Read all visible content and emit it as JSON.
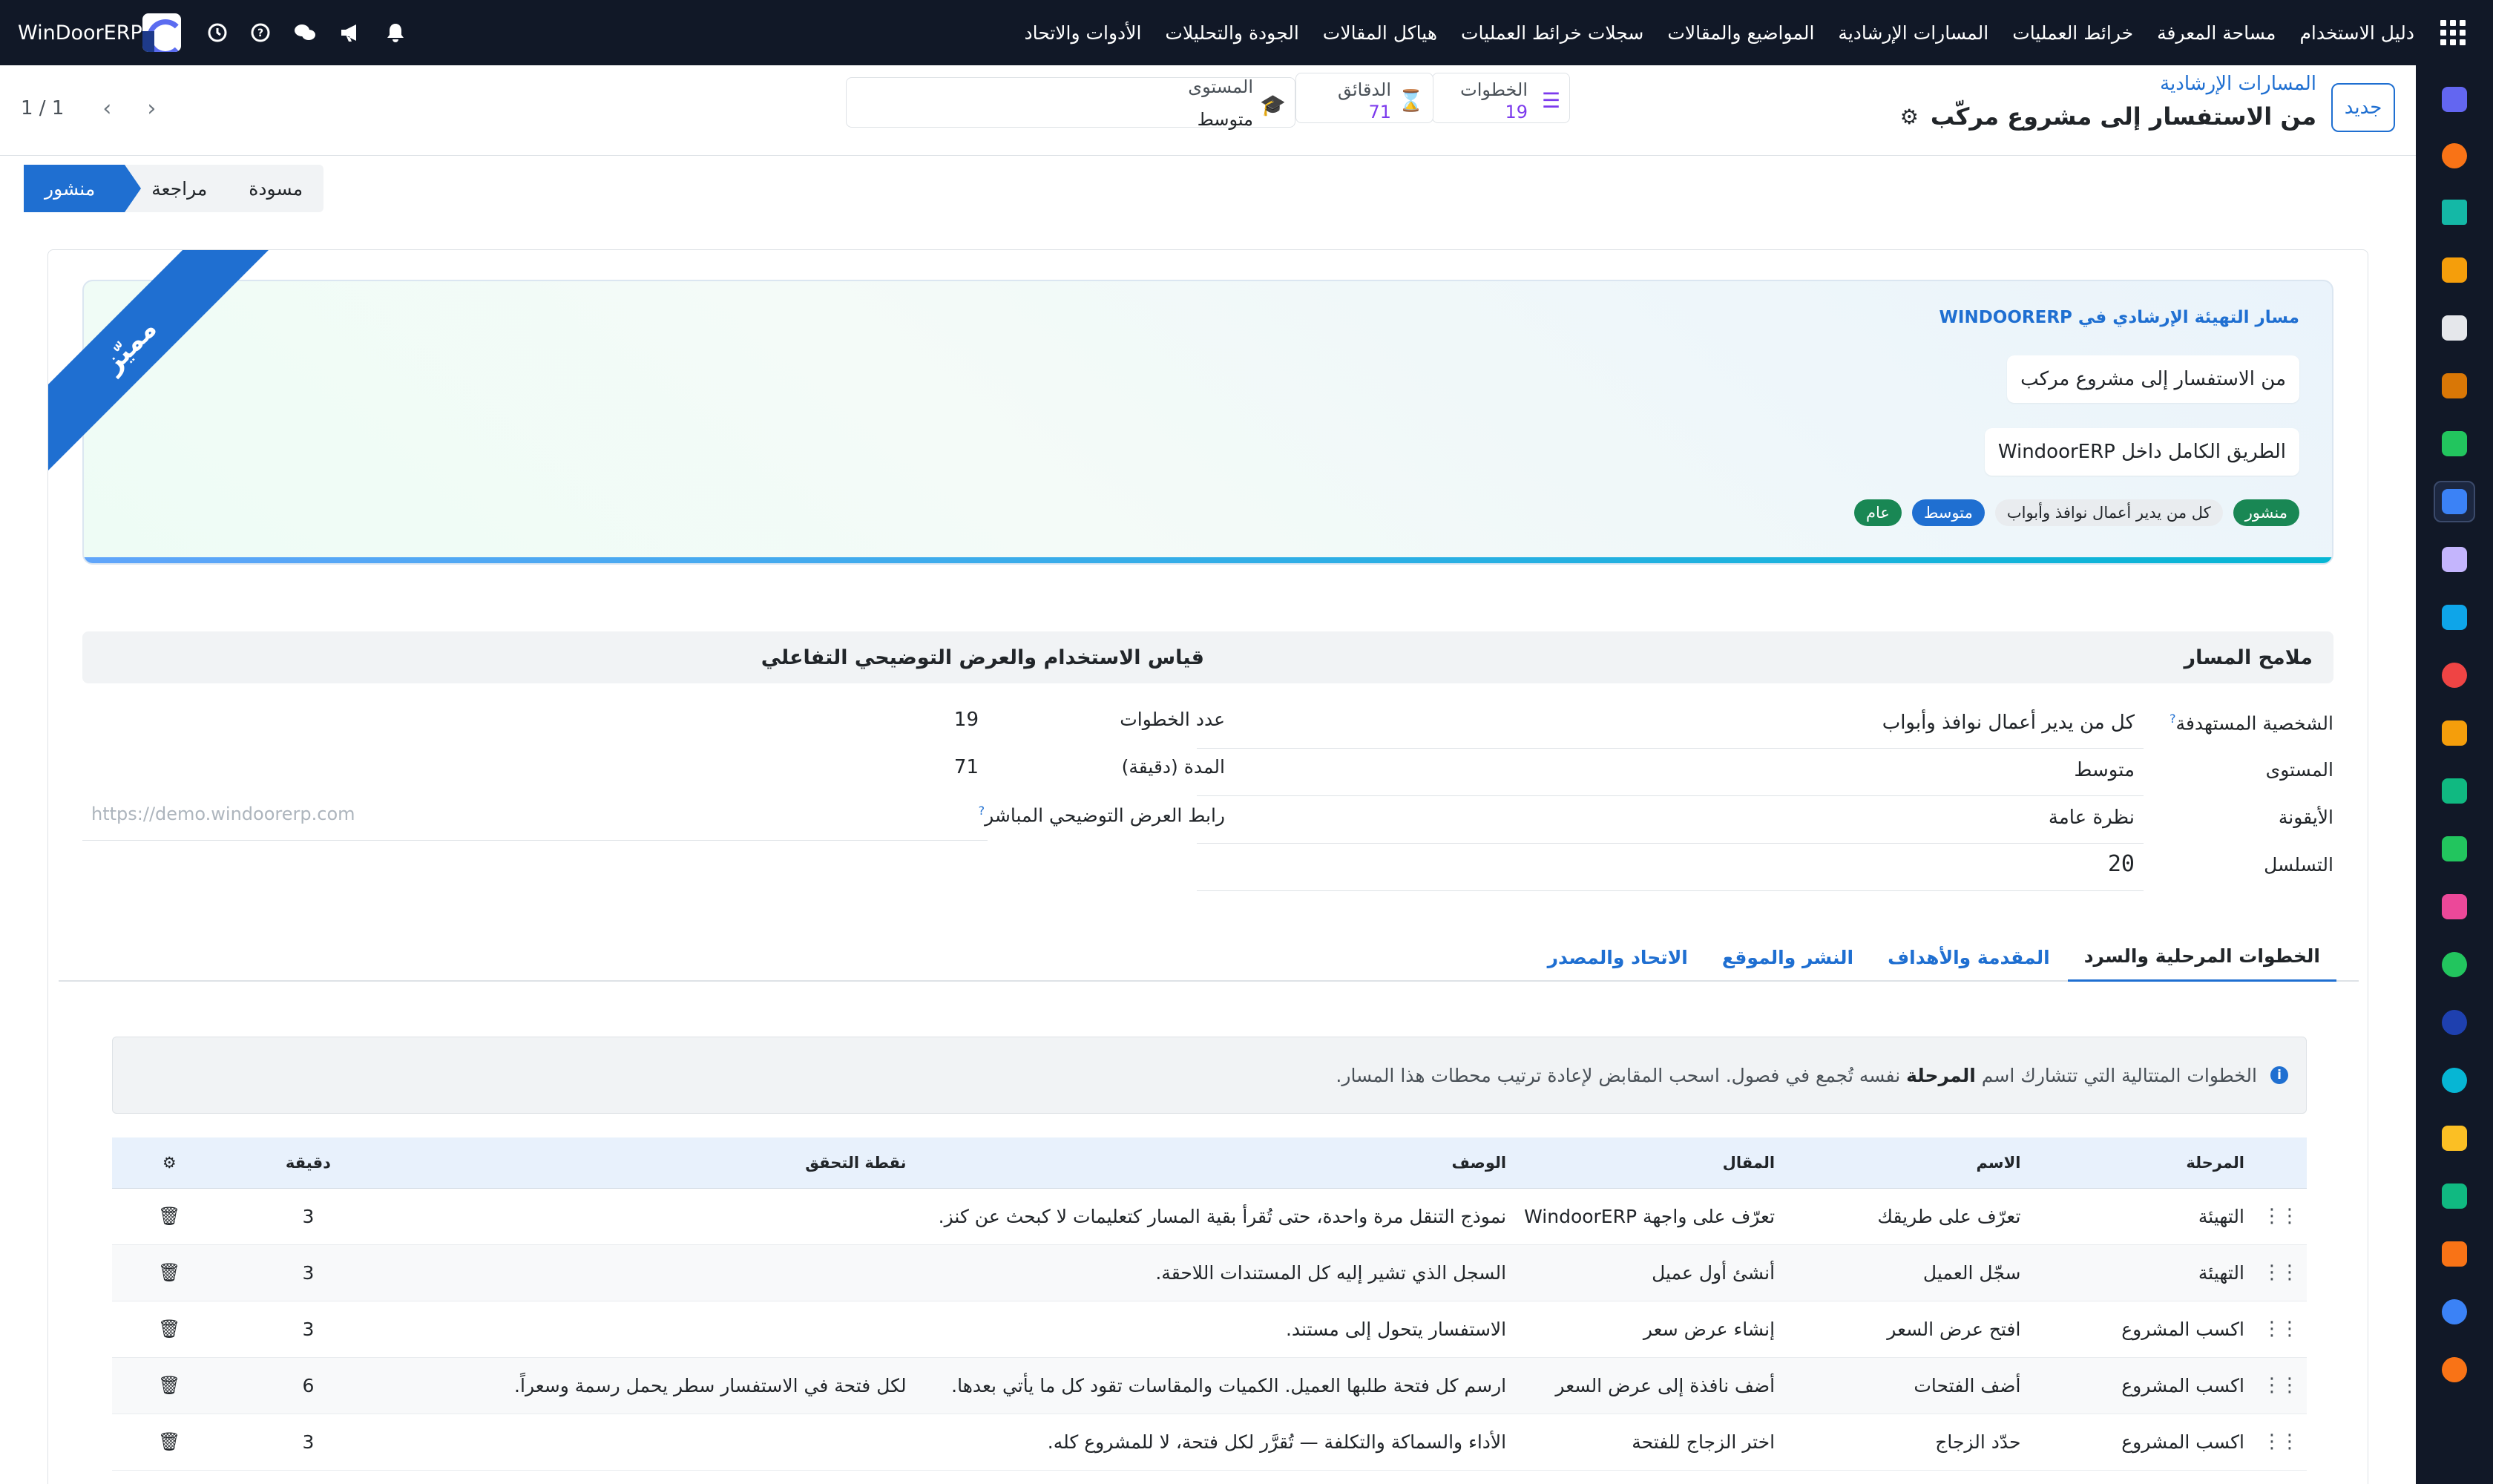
{
  "navbar": {
    "brand": "WinDoorERP",
    "menu": [
      "دليل الاستخدام",
      "مساحة المعرفة",
      "خرائط العمليات",
      "المسارات الإرشادية",
      "المواضيع والمقالات",
      "سجلات خرائط العمليات",
      "هياكل المقالات",
      "الجودة والتحليلات",
      "الأدوات والاتحاد"
    ]
  },
  "control_panel": {
    "new_label": "جديد",
    "breadcrumb_parent": "المسارات الإرشادية",
    "record_title": "من الاستفسار إلى مشروع مركّب",
    "stats": {
      "steps_label": "الخطوات",
      "steps_value": "19",
      "minutes_label": "الدقائق",
      "minutes_value": "71",
      "level_label": "المستوى",
      "level_value": "متوسط"
    },
    "pager": "1 / 1"
  },
  "statusbar": {
    "stages": [
      "مسودة",
      "مراجعة",
      "منشور"
    ],
    "current": "منشور"
  },
  "hero": {
    "ribbon": "مميّز",
    "eyebrow": "مسار التهيئة الإرشادي في WINDOORERP",
    "title": "من الاستفسار إلى مشروع مركب",
    "subtitle": "الطريق الكامل داخل WindoorERP",
    "tags": [
      "منشور",
      "كل من يدير أعمال نوافذ وأبواب",
      "متوسط",
      "عام"
    ]
  },
  "overview": {
    "heading": "ملامح المسار",
    "persona_label": "الشخصية المستهدفة",
    "persona_value": "كل من يدير أعمال نوافذ وأبواب",
    "level_label": "المستوى",
    "level_value": "متوسط",
    "icon_label": "الأيقونة",
    "icon_value": "نظرة عامة",
    "sequence_label": "التسلسل",
    "sequence_value": "20"
  },
  "measure": {
    "heading": "قياس الاستخدام والعرض التوضيحي التفاعلي",
    "steps_label": "عدد الخطوات",
    "steps_value": "19",
    "duration_label": "المدة (دقيقة)",
    "duration_value": "71",
    "demo_label": "رابط العرض التوضيحي المباشر",
    "demo_placeholder": "https://demo.windoorerp.com"
  },
  "tabs": [
    "الخطوات المرحلية والسرد",
    "المقدمة والأهداف",
    "النشر والموقع",
    "الاتحاد والمصدر"
  ],
  "alert": {
    "before": "الخطوات المتتالية التي تتشارك اسم",
    "bold": "المرحلة",
    "after": "نفسه تُجمع في فصول. اسحب المقابض لإعادة ترتيب محطات هذا المسار."
  },
  "table": {
    "headers": {
      "stage": "المرحلة",
      "name": "الاسم",
      "article": "المقال",
      "description": "الوصف",
      "checkpoint": "نقطة التحقق",
      "minutes": "دقيقة"
    },
    "rows": [
      {
        "stage": "التهيئة",
        "name": "تعرّف على طريقك",
        "article": "تعرّف على واجهة WindoorERP",
        "description": "نموذج التنقل مرة واحدة، حتى تُقرأ بقية المسار كتعليمات لا كبحث عن كنز.",
        "checkpoint": "",
        "minutes": "3"
      },
      {
        "stage": "التهيئة",
        "name": "سجّل العميل",
        "article": "أنشئ أول عميل",
        "description": "السجل الذي تشير إليه كل المستندات اللاحقة.",
        "checkpoint": "",
        "minutes": "3"
      },
      {
        "stage": "اكسب المشروع",
        "name": "افتح عرض السعر",
        "article": "إنشاء عرض سعر",
        "description": "الاستفسار يتحول إلى مستند.",
        "checkpoint": "",
        "minutes": "3"
      },
      {
        "stage": "اكسب المشروع",
        "name": "أضف الفتحات",
        "article": "أضف نافذة إلى عرض السعر",
        "description": "ارسم كل فتحة طلبها العميل. الكميات والمقاسات تقود كل ما يأتي بعدها.",
        "checkpoint": "لكل فتحة في الاستفسار سطر يحمل رسمة وسعراً.",
        "minutes": "6"
      },
      {
        "stage": "اكسب المشروع",
        "name": "حدّد الزجاج",
        "article": "اختر الزجاج للفتحة",
        "description": "الأداء والسماكة والتكلفة — تُقرَّر لكل فتحة، لا للمشروع كله.",
        "checkpoint": "",
        "minutes": "3"
      }
    ]
  },
  "colors": {
    "primary": "#1f6fd1",
    "navbar": "#111827",
    "success": "#198754",
    "purple": "#7c3aed"
  }
}
